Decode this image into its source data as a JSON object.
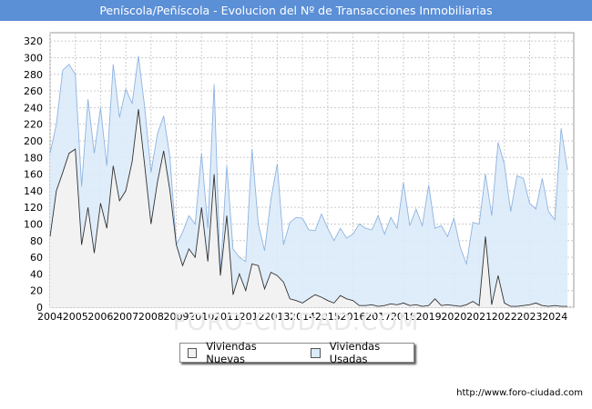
{
  "title": "Peníscola/Peñíscola - Evolucion del Nº de Transacciones Inmobiliarias",
  "source": "http://www.foro-ciudad.com",
  "watermark": "FORO-CIUDAD.COM",
  "chart_data": {
    "type": "area",
    "title": "Peníscola/Peñíscola - Evolucion del Nº de Transacciones Inmobiliarias",
    "xlabel": "",
    "ylabel": "",
    "xlim": [
      2004,
      2024.75
    ],
    "ylim": [
      0,
      330
    ],
    "yticks": [
      0,
      20,
      40,
      60,
      80,
      100,
      120,
      140,
      160,
      180,
      200,
      220,
      240,
      260,
      280,
      300,
      320
    ],
    "xticks": [
      "2004",
      "2005",
      "2006",
      "2007",
      "2008",
      "2009",
      "2010",
      "2011",
      "2012",
      "2013",
      "2014",
      "2015",
      "2016",
      "2017",
      "2018",
      "2019",
      "2020",
      "2021",
      "2022",
      "2023",
      "2024"
    ],
    "grid": true,
    "legend_position": "bottom",
    "colors": {
      "nuevas_fill": "#f2f2f2",
      "nuevas_line": "#333333",
      "usadas_fill": "#dcebfa",
      "usadas_line": "#8fb3e0"
    },
    "quarters": [
      "2004Q1",
      "2004Q2",
      "2004Q3",
      "2004Q4",
      "2005Q1",
      "2005Q2",
      "2005Q3",
      "2005Q4",
      "2006Q1",
      "2006Q2",
      "2006Q3",
      "2006Q4",
      "2007Q1",
      "2007Q2",
      "2007Q3",
      "2007Q4",
      "2008Q1",
      "2008Q2",
      "2008Q3",
      "2008Q4",
      "2009Q1",
      "2009Q2",
      "2009Q3",
      "2009Q4",
      "2010Q1",
      "2010Q2",
      "2010Q3",
      "2010Q4",
      "2011Q1",
      "2011Q2",
      "2011Q3",
      "2011Q4",
      "2012Q1",
      "2012Q2",
      "2012Q3",
      "2012Q4",
      "2013Q1",
      "2013Q2",
      "2013Q3",
      "2013Q4",
      "2014Q1",
      "2014Q2",
      "2014Q3",
      "2014Q4",
      "2015Q1",
      "2015Q2",
      "2015Q3",
      "2015Q4",
      "2016Q1",
      "2016Q2",
      "2016Q3",
      "2016Q4",
      "2017Q1",
      "2017Q2",
      "2017Q3",
      "2017Q4",
      "2018Q1",
      "2018Q2",
      "2018Q3",
      "2018Q4",
      "2019Q1",
      "2019Q2",
      "2019Q3",
      "2019Q4",
      "2020Q1",
      "2020Q2",
      "2020Q3",
      "2020Q4",
      "2021Q1",
      "2021Q2",
      "2021Q3",
      "2021Q4",
      "2022Q1",
      "2022Q2",
      "2022Q3",
      "2022Q4",
      "2023Q1",
      "2023Q2",
      "2023Q3",
      "2023Q4",
      "2024Q1",
      "2024Q2",
      "2024Q3"
    ],
    "series": [
      {
        "name": "Viviendas Nuevas",
        "values": [
          85,
          140,
          162,
          185,
          190,
          75,
          120,
          65,
          125,
          95,
          170,
          128,
          140,
          175,
          238,
          170,
          100,
          150,
          188,
          140,
          75,
          50,
          70,
          60,
          120,
          55,
          160,
          38,
          110,
          15,
          40,
          20,
          52,
          50,
          22,
          42,
          38,
          30,
          10,
          8,
          5,
          10,
          15,
          12,
          8,
          5,
          14,
          10,
          8,
          2,
          2,
          3,
          1,
          2,
          4,
          3,
          5,
          2,
          3,
          1,
          2,
          10,
          2,
          3,
          2,
          1,
          3,
          7,
          2,
          85,
          3,
          38,
          5,
          1,
          1,
          2,
          3,
          5,
          2,
          1,
          2,
          1,
          1
        ]
      },
      {
        "name": "Viviendas Usadas",
        "values": [
          185,
          220,
          285,
          292,
          280,
          145,
          250,
          185,
          240,
          170,
          292,
          228,
          262,
          245,
          302,
          240,
          162,
          208,
          230,
          180,
          75,
          90,
          110,
          100,
          185,
          95,
          268,
          40,
          170,
          70,
          60,
          55,
          190,
          100,
          68,
          130,
          172,
          75,
          102,
          108,
          107,
          93,
          92,
          112,
          95,
          80,
          95,
          83,
          88,
          100,
          95,
          93,
          110,
          88,
          108,
          95,
          150,
          98,
          118,
          98,
          147,
          95,
          98,
          85,
          107,
          72,
          52,
          102,
          100,
          160,
          110,
          198,
          172,
          115,
          158,
          155,
          125,
          118,
          155,
          115,
          105,
          215,
          165
        ]
      }
    ]
  },
  "legend": {
    "items": [
      "Viviendas Nuevas",
      "Viviendas Usadas"
    ]
  }
}
